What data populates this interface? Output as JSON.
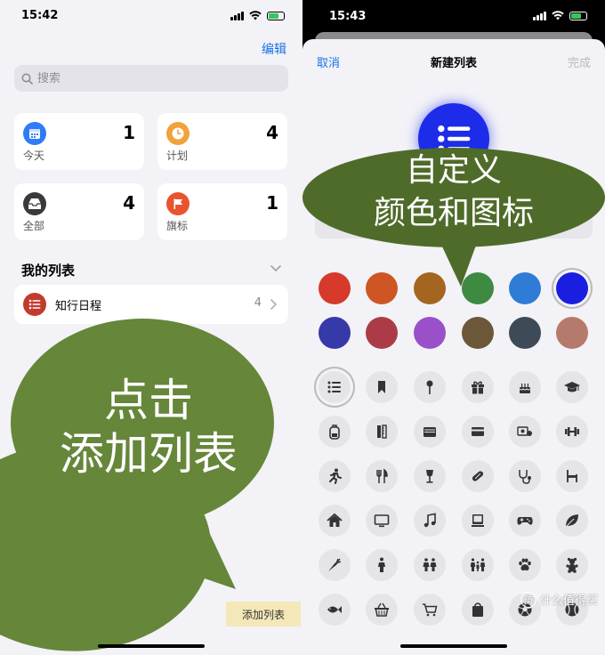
{
  "left": {
    "status_time": "15:42",
    "edit_label": "编辑",
    "search_placeholder": "搜索",
    "cards": [
      {
        "label": "今天",
        "count": "1",
        "color": "#2f7cf6",
        "icon": "calendar-icon"
      },
      {
        "label": "计划",
        "count": "4",
        "color": "#f0a23b",
        "icon": "clock-icon"
      },
      {
        "label": "全部",
        "count": "4",
        "color": "#3a3a3c",
        "icon": "tray-icon"
      },
      {
        "label": "旗标",
        "count": "1",
        "color": "#e8542f",
        "icon": "flag-icon"
      }
    ],
    "my_lists_title": "我的列表",
    "lists": [
      {
        "name": "知行日程",
        "count": "4",
        "color": "#c23b2c",
        "icon": "list-icon"
      }
    ],
    "add_list_label": "添加列表",
    "bubble_line1": "点击",
    "bubble_line2": "添加列表"
  },
  "right": {
    "status_time": "15:43",
    "cancel_label": "取消",
    "title": "新建列表",
    "done_label": "完成",
    "preview_color": "#1c2ce8",
    "bubble_line1": "自定义",
    "bubble_line2": "颜色和图标",
    "colors": [
      "#d7392b",
      "#cf5524",
      "#a36520",
      "#3e8a43",
      "#2f7cd7",
      "#1a1ee0",
      "#3639a8",
      "#ab3c47",
      "#9a50c9",
      "#6c5838",
      "#3e4a58",
      "#b57a6b"
    ],
    "selected_color_index": 5,
    "icons": [
      "list-icon",
      "bookmark-icon",
      "pin-icon",
      "gift-icon",
      "cake-icon",
      "graduation-cap-icon",
      "backpack-icon",
      "ruler-icon",
      "wallet-icon",
      "credit-card-icon",
      "money-icon",
      "dumbbell-icon",
      "running-icon",
      "fork-knife-icon",
      "wine-glass-icon",
      "pill-icon",
      "stethoscope-icon",
      "chair-icon",
      "house-icon",
      "tv-icon",
      "music-note-icon",
      "computer-icon",
      "gamepad-icon",
      "leaf-icon",
      "carrot-icon",
      "person-icon",
      "two-people-icon",
      "family-icon",
      "paw-icon",
      "teddy-bear-icon",
      "fish-icon",
      "basket-icon",
      "cart-icon",
      "shopping-bag-icon",
      "soccer-ball-icon",
      "baseball-icon"
    ],
    "selected_icon_index": 0,
    "watermark_text": "什么值得买",
    "watermark_badge": "值"
  }
}
